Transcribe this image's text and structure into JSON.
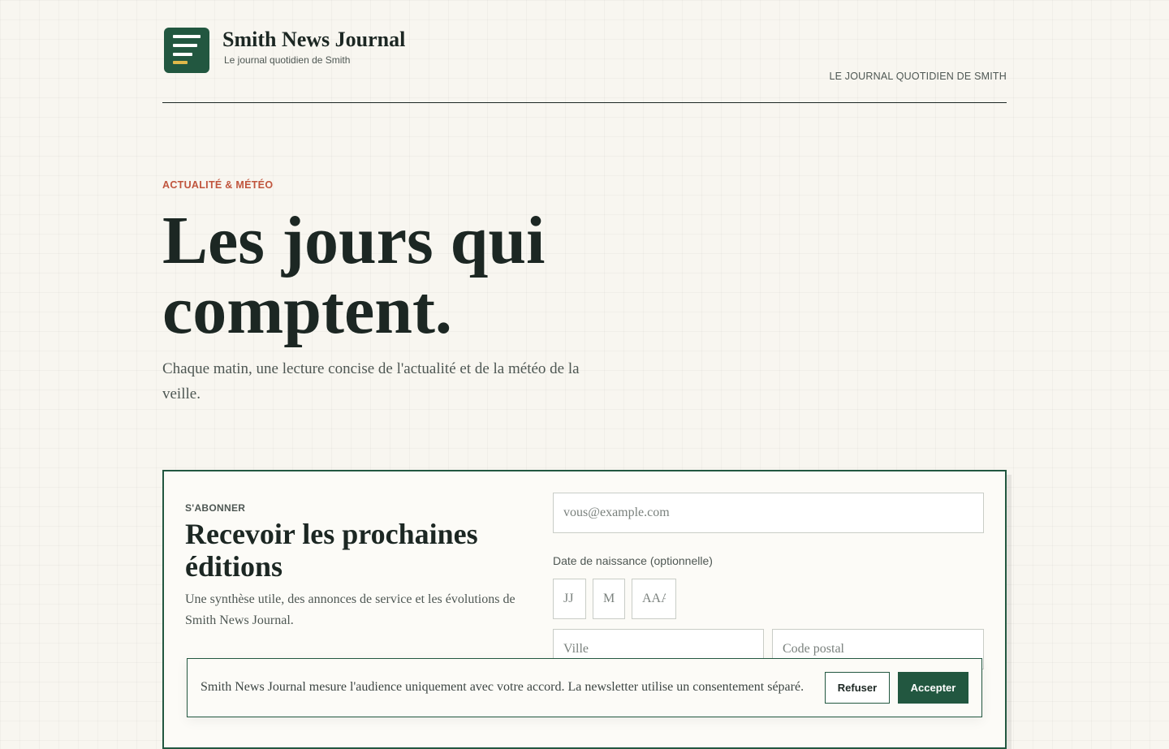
{
  "header": {
    "brand_name": "Smith News Journal",
    "brand_tagline": "Le journal quotidien de Smith",
    "right_label": "LE JOURNAL QUOTIDIEN DE SMITH"
  },
  "hero": {
    "eyebrow": "ACTUALITÉ & MÉTÉO",
    "title": "Les jours qui comptent.",
    "subtitle": "Chaque matin, une lecture concise de l'actualité et de la météo de la veille."
  },
  "subscribe": {
    "eyebrow": "S'ABONNER",
    "title": "Recevoir les prochaines éditions",
    "description": "Une synthèse utile, des annonces de service et les évolutions de Smith News Journal.",
    "email_placeholder": "vous@example.com",
    "dob_label": "Date de naissance (optionnelle)",
    "dob_day_placeholder": "JJ",
    "dob_month_placeholder": "MM",
    "dob_year_placeholder": "AAAA",
    "city_placeholder": "Ville",
    "postal_placeholder": "Code postal"
  },
  "consent": {
    "text": "Smith News Journal mesure l'audience uniquement avec votre accord. La newsletter utilise un consentement séparé.",
    "refuse_label": "Refuser",
    "accept_label": "Accepter"
  },
  "colors": {
    "brand_green": "#225740",
    "accent_red": "#c0553d",
    "logo_yellow": "#e0b84a",
    "background": "#f8f6f0"
  },
  "icons": {
    "logo": "newspaper-lines-icon"
  }
}
